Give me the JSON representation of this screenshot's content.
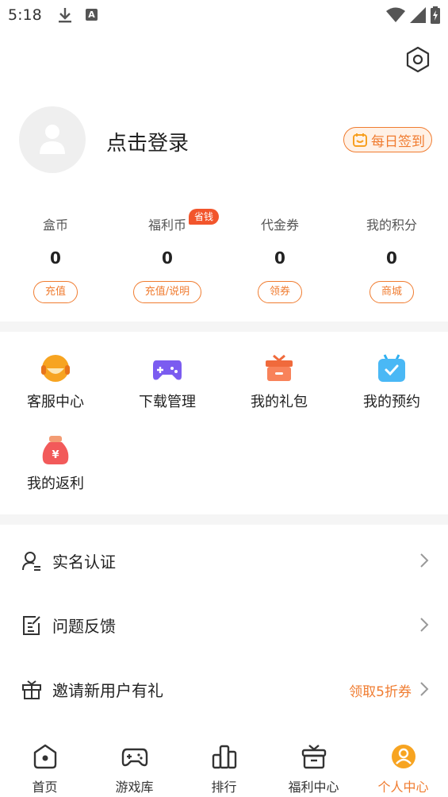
{
  "status_bar": {
    "time": "5:18"
  },
  "profile": {
    "login_text": "点击登录",
    "checkin_label": "每日签到"
  },
  "stats": [
    {
      "label": "盒币",
      "value": "0",
      "button": "充值"
    },
    {
      "label": "福利币",
      "value": "0",
      "button": "充值/说明",
      "badge": "省钱"
    },
    {
      "label": "代金券",
      "value": "0",
      "button": "领券"
    },
    {
      "label": "我的积分",
      "value": "0",
      "button": "商城"
    }
  ],
  "grid": [
    {
      "label": "客服中心",
      "icon": "customer-service-icon"
    },
    {
      "label": "下载管理",
      "icon": "gamepad-download-icon"
    },
    {
      "label": "我的礼包",
      "icon": "gift-box-icon"
    },
    {
      "label": "我的预约",
      "icon": "calendar-check-icon"
    },
    {
      "label": "我的返利",
      "icon": "money-bag-icon"
    }
  ],
  "list": [
    {
      "label": "实名认证",
      "icon": "user-verify-icon",
      "right": ""
    },
    {
      "label": "问题反馈",
      "icon": "feedback-edit-icon",
      "right": ""
    },
    {
      "label": "邀请新用户有礼",
      "icon": "gift-icon",
      "right": "领取5折券"
    }
  ],
  "nav": [
    {
      "label": "首页",
      "icon": "home-icon"
    },
    {
      "label": "游戏库",
      "icon": "gamepad-icon"
    },
    {
      "label": "排行",
      "icon": "ranking-icon"
    },
    {
      "label": "福利中心",
      "icon": "gift-icon"
    },
    {
      "label": "个人中心",
      "icon": "user-icon",
      "active": true
    }
  ],
  "colors": {
    "accent": "#f07c30",
    "badge": "#f2552c",
    "divider": "#f5f5f5"
  }
}
